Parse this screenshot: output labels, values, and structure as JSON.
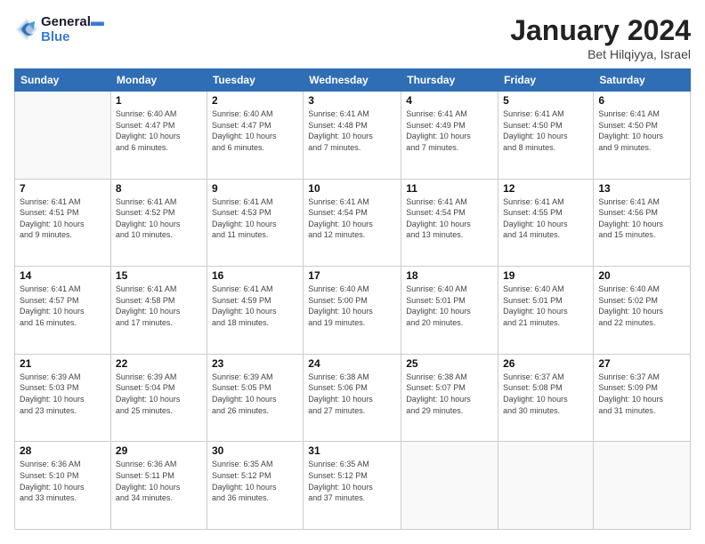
{
  "header": {
    "logo_line1": "General",
    "logo_line2": "Blue",
    "month_title": "January 2024",
    "subtitle": "Bet Hilqiyya, Israel"
  },
  "days_of_week": [
    "Sunday",
    "Monday",
    "Tuesday",
    "Wednesday",
    "Thursday",
    "Friday",
    "Saturday"
  ],
  "weeks": [
    [
      {
        "day": "",
        "info": ""
      },
      {
        "day": "1",
        "info": "Sunrise: 6:40 AM\nSunset: 4:47 PM\nDaylight: 10 hours\nand 6 minutes."
      },
      {
        "day": "2",
        "info": "Sunrise: 6:40 AM\nSunset: 4:47 PM\nDaylight: 10 hours\nand 6 minutes."
      },
      {
        "day": "3",
        "info": "Sunrise: 6:41 AM\nSunset: 4:48 PM\nDaylight: 10 hours\nand 7 minutes."
      },
      {
        "day": "4",
        "info": "Sunrise: 6:41 AM\nSunset: 4:49 PM\nDaylight: 10 hours\nand 7 minutes."
      },
      {
        "day": "5",
        "info": "Sunrise: 6:41 AM\nSunset: 4:50 PM\nDaylight: 10 hours\nand 8 minutes."
      },
      {
        "day": "6",
        "info": "Sunrise: 6:41 AM\nSunset: 4:50 PM\nDaylight: 10 hours\nand 9 minutes."
      }
    ],
    [
      {
        "day": "7",
        "info": "Sunrise: 6:41 AM\nSunset: 4:51 PM\nDaylight: 10 hours\nand 9 minutes."
      },
      {
        "day": "8",
        "info": "Sunrise: 6:41 AM\nSunset: 4:52 PM\nDaylight: 10 hours\nand 10 minutes."
      },
      {
        "day": "9",
        "info": "Sunrise: 6:41 AM\nSunset: 4:53 PM\nDaylight: 10 hours\nand 11 minutes."
      },
      {
        "day": "10",
        "info": "Sunrise: 6:41 AM\nSunset: 4:54 PM\nDaylight: 10 hours\nand 12 minutes."
      },
      {
        "day": "11",
        "info": "Sunrise: 6:41 AM\nSunset: 4:54 PM\nDaylight: 10 hours\nand 13 minutes."
      },
      {
        "day": "12",
        "info": "Sunrise: 6:41 AM\nSunset: 4:55 PM\nDaylight: 10 hours\nand 14 minutes."
      },
      {
        "day": "13",
        "info": "Sunrise: 6:41 AM\nSunset: 4:56 PM\nDaylight: 10 hours\nand 15 minutes."
      }
    ],
    [
      {
        "day": "14",
        "info": "Sunrise: 6:41 AM\nSunset: 4:57 PM\nDaylight: 10 hours\nand 16 minutes."
      },
      {
        "day": "15",
        "info": "Sunrise: 6:41 AM\nSunset: 4:58 PM\nDaylight: 10 hours\nand 17 minutes."
      },
      {
        "day": "16",
        "info": "Sunrise: 6:41 AM\nSunset: 4:59 PM\nDaylight: 10 hours\nand 18 minutes."
      },
      {
        "day": "17",
        "info": "Sunrise: 6:40 AM\nSunset: 5:00 PM\nDaylight: 10 hours\nand 19 minutes."
      },
      {
        "day": "18",
        "info": "Sunrise: 6:40 AM\nSunset: 5:01 PM\nDaylight: 10 hours\nand 20 minutes."
      },
      {
        "day": "19",
        "info": "Sunrise: 6:40 AM\nSunset: 5:01 PM\nDaylight: 10 hours\nand 21 minutes."
      },
      {
        "day": "20",
        "info": "Sunrise: 6:40 AM\nSunset: 5:02 PM\nDaylight: 10 hours\nand 22 minutes."
      }
    ],
    [
      {
        "day": "21",
        "info": "Sunrise: 6:39 AM\nSunset: 5:03 PM\nDaylight: 10 hours\nand 23 minutes."
      },
      {
        "day": "22",
        "info": "Sunrise: 6:39 AM\nSunset: 5:04 PM\nDaylight: 10 hours\nand 25 minutes."
      },
      {
        "day": "23",
        "info": "Sunrise: 6:39 AM\nSunset: 5:05 PM\nDaylight: 10 hours\nand 26 minutes."
      },
      {
        "day": "24",
        "info": "Sunrise: 6:38 AM\nSunset: 5:06 PM\nDaylight: 10 hours\nand 27 minutes."
      },
      {
        "day": "25",
        "info": "Sunrise: 6:38 AM\nSunset: 5:07 PM\nDaylight: 10 hours\nand 29 minutes."
      },
      {
        "day": "26",
        "info": "Sunrise: 6:37 AM\nSunset: 5:08 PM\nDaylight: 10 hours\nand 30 minutes."
      },
      {
        "day": "27",
        "info": "Sunrise: 6:37 AM\nSunset: 5:09 PM\nDaylight: 10 hours\nand 31 minutes."
      }
    ],
    [
      {
        "day": "28",
        "info": "Sunrise: 6:36 AM\nSunset: 5:10 PM\nDaylight: 10 hours\nand 33 minutes."
      },
      {
        "day": "29",
        "info": "Sunrise: 6:36 AM\nSunset: 5:11 PM\nDaylight: 10 hours\nand 34 minutes."
      },
      {
        "day": "30",
        "info": "Sunrise: 6:35 AM\nSunset: 5:12 PM\nDaylight: 10 hours\nand 36 minutes."
      },
      {
        "day": "31",
        "info": "Sunrise: 6:35 AM\nSunset: 5:12 PM\nDaylight: 10 hours\nand 37 minutes."
      },
      {
        "day": "",
        "info": ""
      },
      {
        "day": "",
        "info": ""
      },
      {
        "day": "",
        "info": ""
      }
    ]
  ]
}
